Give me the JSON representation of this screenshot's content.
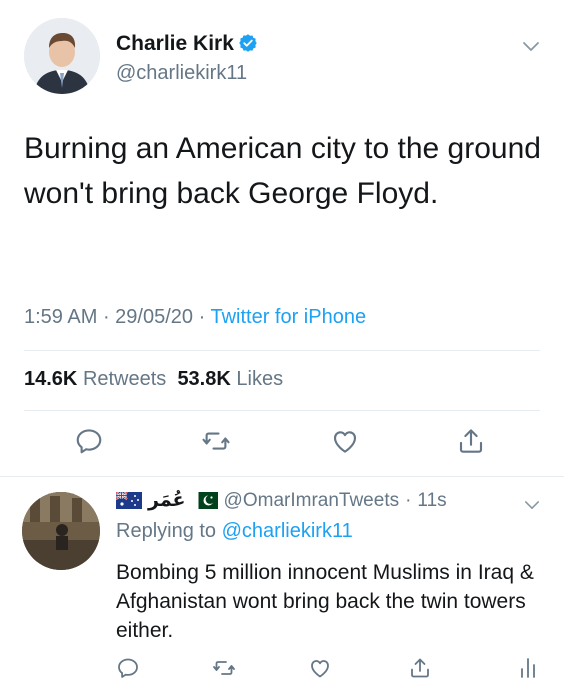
{
  "main_tweet": {
    "author_name": "Charlie Kirk",
    "handle": "@charliekirk11",
    "text": "Burning an American city to the ground won't bring back George Floyd.",
    "time": "1:59 AM",
    "date": "29/05/20",
    "source": "Twitter for iPhone",
    "retweets_count": "14.6K",
    "retweets_label": "Retweets",
    "likes_count": "53.8K",
    "likes_label": "Likes"
  },
  "reply": {
    "author_name": "عُمَر",
    "handle": "@OmarImranTweets",
    "time_ago": "11s",
    "replying_label": "Replying to",
    "replying_to": "@charliekirk11",
    "text": "Bombing 5 million innocent Muslims in Iraq & Afghanistan wont bring back the twin towers either."
  },
  "icons": {
    "verified": "verified-badge-icon",
    "reply": "reply-icon",
    "retweet": "retweet-icon",
    "like": "heart-icon",
    "share": "share-icon",
    "analytics": "analytics-icon",
    "more": "chevron-down-icon"
  },
  "colors": {
    "accent": "#1da1f2",
    "secondary_text": "#657786",
    "primary_text": "#14171a",
    "divider": "#e6ecf0"
  }
}
